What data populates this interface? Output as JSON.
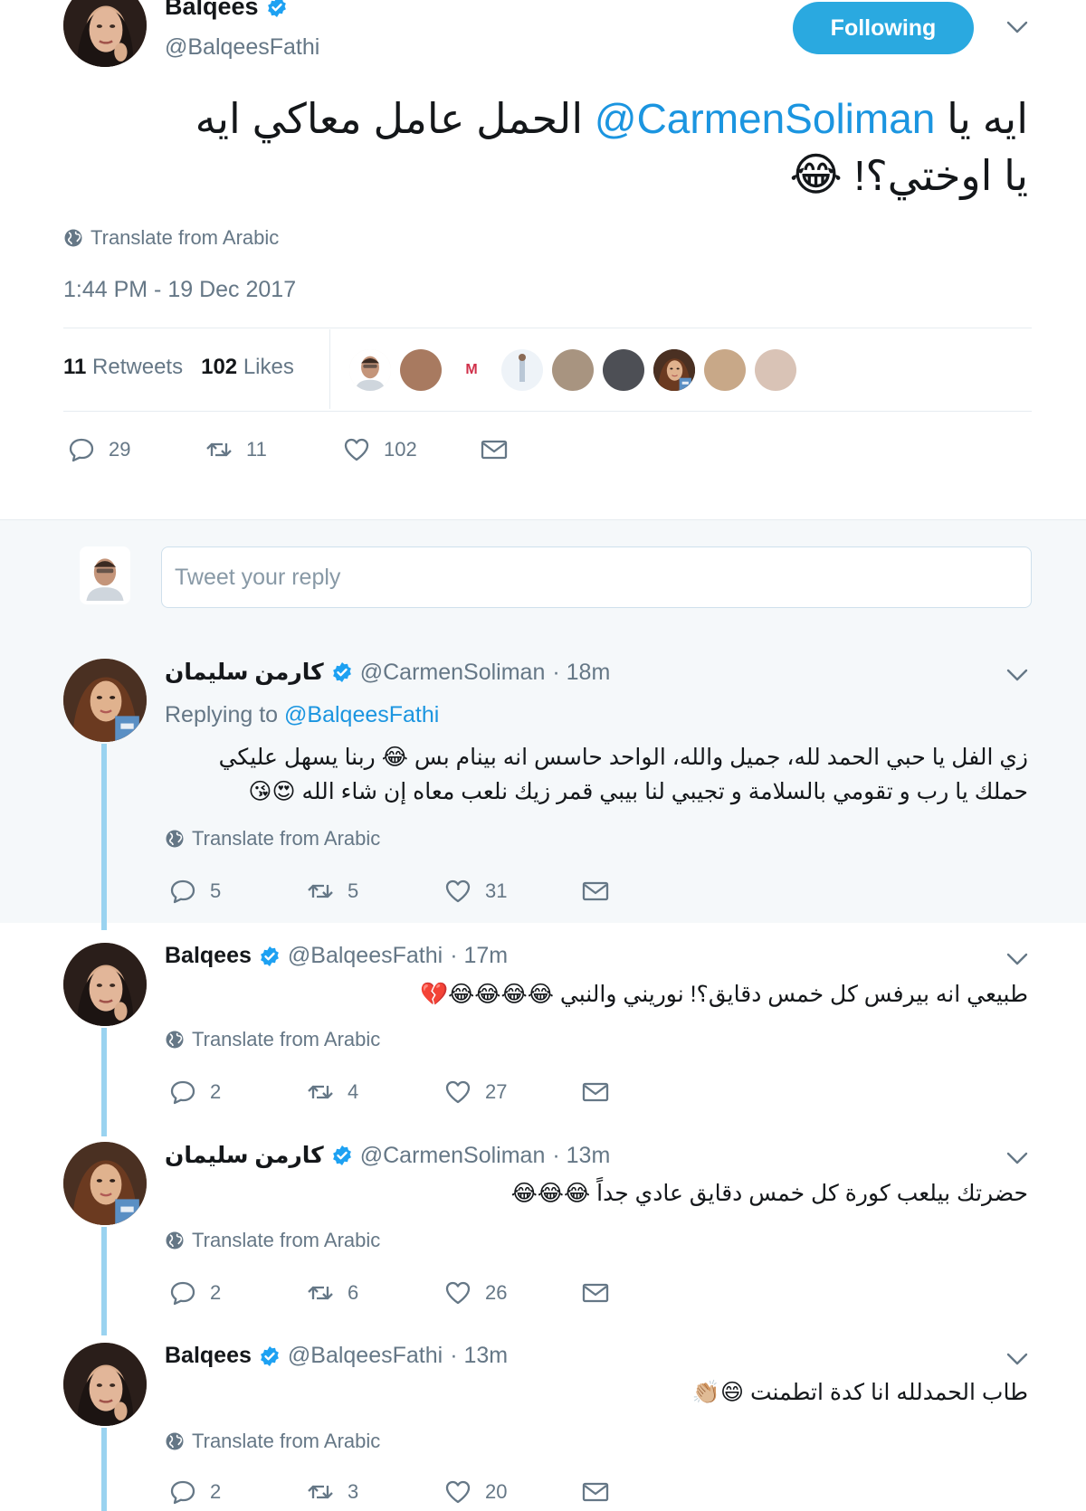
{
  "main_tweet": {
    "name": "Balqees",
    "handle": "@BalqeesFathi",
    "follow_label": "Following",
    "text_line1_part1": "ايه يا ",
    "mention": "@CarmenSoliman",
    "text_line1_part2": " الحمل عامل معاكي ايه",
    "text_line2": "يا اوختي؟!",
    "emoji": "😂",
    "translate": "Translate from Arabic",
    "timestamp": "1:44 PM - 19 Dec 2017",
    "retweets_count": "11",
    "retweets_label": "Retweets",
    "likes_count": "102",
    "likes_label": "Likes",
    "actions": {
      "replies": "29",
      "retweets": "11",
      "likes": "102"
    }
  },
  "reply_box": {
    "placeholder": "Tweet your reply"
  },
  "replies": [
    {
      "name": "كارمن سليمان",
      "handle": "@CarmenSoliman",
      "time": "· 18m",
      "replying_prefix": "Replying to",
      "replying_to": "@BalqeesFathi",
      "line1": "زي الفل يا حبي الحمد لله، جميل والله، الواحد حاسس انه بينام بس 😂 ربنا يسهل عليكي",
      "line2": "حملك يا رب و تقومي بالسلامة و تجيبي لنا بيبي قمر زيك نلعب معاه إن شاء الله 😍😘",
      "translate": "Translate from Arabic",
      "replies": "5",
      "retweets": "5",
      "likes": "31"
    },
    {
      "name": "Balqees",
      "handle": "@BalqeesFathi",
      "time": "· 17m",
      "line1": "طبيعي انه بيرفس كل خمس دقايق؟! نوريني والنبي 😂😂😂😂💔",
      "translate": "Translate from Arabic",
      "replies": "2",
      "retweets": "4",
      "likes": "27"
    },
    {
      "name": "كارمن سليمان",
      "handle": "@CarmenSoliman",
      "time": "· 13m",
      "line1": "حضرتك بيلعب كورة كل خمس دقايق عادي جداً 😂😂😂",
      "translate": "Translate from Arabic",
      "replies": "2",
      "retweets": "6",
      "likes": "26"
    },
    {
      "name": "Balqees",
      "handle": "@BalqeesFathi",
      "time": "· 13m",
      "line1": "طاب الحمدلله انا كدة اتطمنت 😄👏🏼",
      "translate": "Translate from Arabic",
      "replies": "2",
      "retweets": "3",
      "likes": "20"
    }
  ],
  "colors": {
    "accent": "#1da1f2",
    "follow_button": "#2aa9e0",
    "thread_line": "#9ad3f0",
    "highlight_bg": "#f5f8fa"
  }
}
